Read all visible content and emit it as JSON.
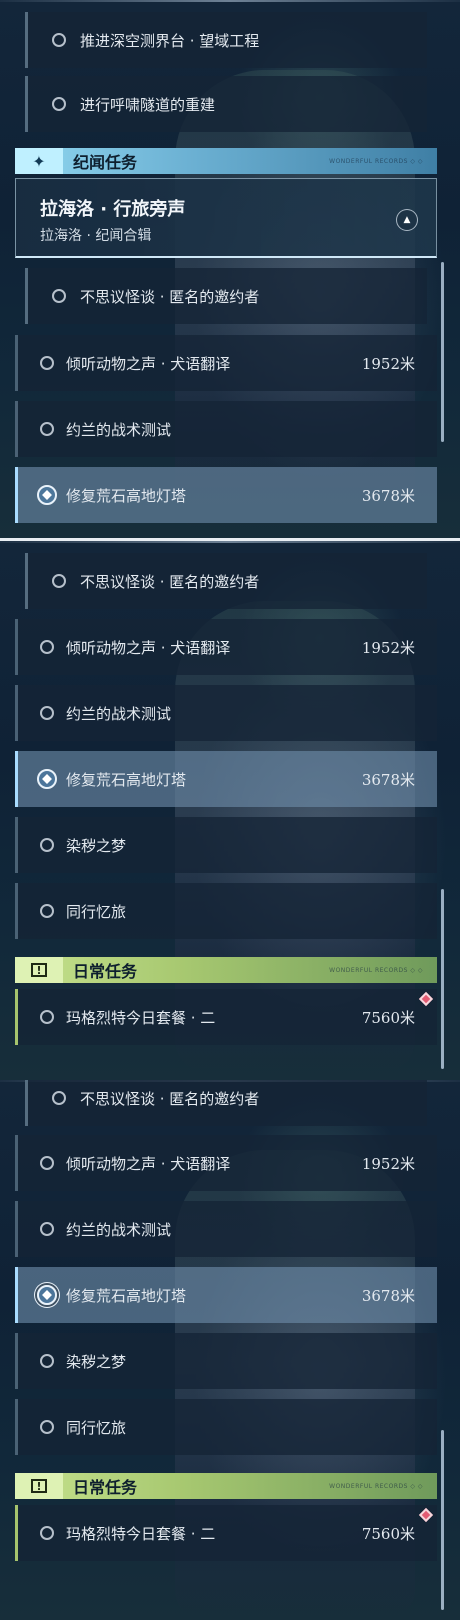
{
  "panel1": {
    "top_subtasks": [
      {
        "label": "推进深空测界台 · 望域工程"
      },
      {
        "label": "进行呼啸隧道的重建"
      }
    ],
    "story_header": {
      "title": "纪闻任务",
      "icon": "sparkle-icon",
      "deco": "WONDERFUL RECORDS ◇ ◇"
    },
    "quest_card": {
      "title": "拉海洛 · 行旅旁声",
      "subtitle": "拉海洛 · 纪闻合辑",
      "collapse_icon": "▲"
    },
    "subtasks": [
      {
        "label": "不思议怪谈 · 匿名的邀约者"
      }
    ],
    "quests": [
      {
        "label": "倾听动物之声 · 犬语翻译",
        "distance": "1952米"
      },
      {
        "label": "约兰的战术测试",
        "distance": ""
      },
      {
        "label": "修复荒石高地灯塔",
        "distance": "3678米",
        "active": true
      }
    ]
  },
  "panel2": {
    "subtasks": [
      {
        "label": "不思议怪谈 · 匿名的邀约者"
      }
    ],
    "quests": [
      {
        "label": "倾听动物之声 · 犬语翻译",
        "distance": "1952米"
      },
      {
        "label": "约兰的战术测试",
        "distance": ""
      },
      {
        "label": "修复荒石高地灯塔",
        "distance": "3678米",
        "active": true
      },
      {
        "label": "染秽之梦",
        "distance": ""
      },
      {
        "label": "同行忆旅",
        "distance": ""
      }
    ],
    "daily_header": {
      "title": "日常任务",
      "icon": "exclamation-icon",
      "deco": "WONDERFUL RECORDS ◇ ◇"
    },
    "daily_quests": [
      {
        "label": "玛格烈特今日套餐 · 二",
        "distance": "7560米"
      }
    ]
  },
  "panel3": {
    "subtasks": [
      {
        "label": "不思议怪谈 · 匿名的邀约者"
      }
    ],
    "quests": [
      {
        "label": "倾听动物之声 · 犬语翻译",
        "distance": "1952米"
      },
      {
        "label": "约兰的战术测试",
        "distance": ""
      },
      {
        "label": "修复荒石高地灯塔",
        "distance": "3678米",
        "active": true
      },
      {
        "label": "染秽之梦",
        "distance": ""
      },
      {
        "label": "同行忆旅",
        "distance": ""
      }
    ],
    "daily_header": {
      "title": "日常任务",
      "icon": "exclamation-icon",
      "deco": "WONDERFUL RECORDS ◇ ◇"
    },
    "daily_quests": [
      {
        "label": "玛格烈特今日套餐 · 二",
        "distance": "7560米"
      }
    ]
  },
  "colors": {
    "story_accent": "#8fd6ef",
    "daily_accent": "#a6c46d",
    "active_row": "#6e8caa",
    "pin_marker": "#e35b73"
  }
}
